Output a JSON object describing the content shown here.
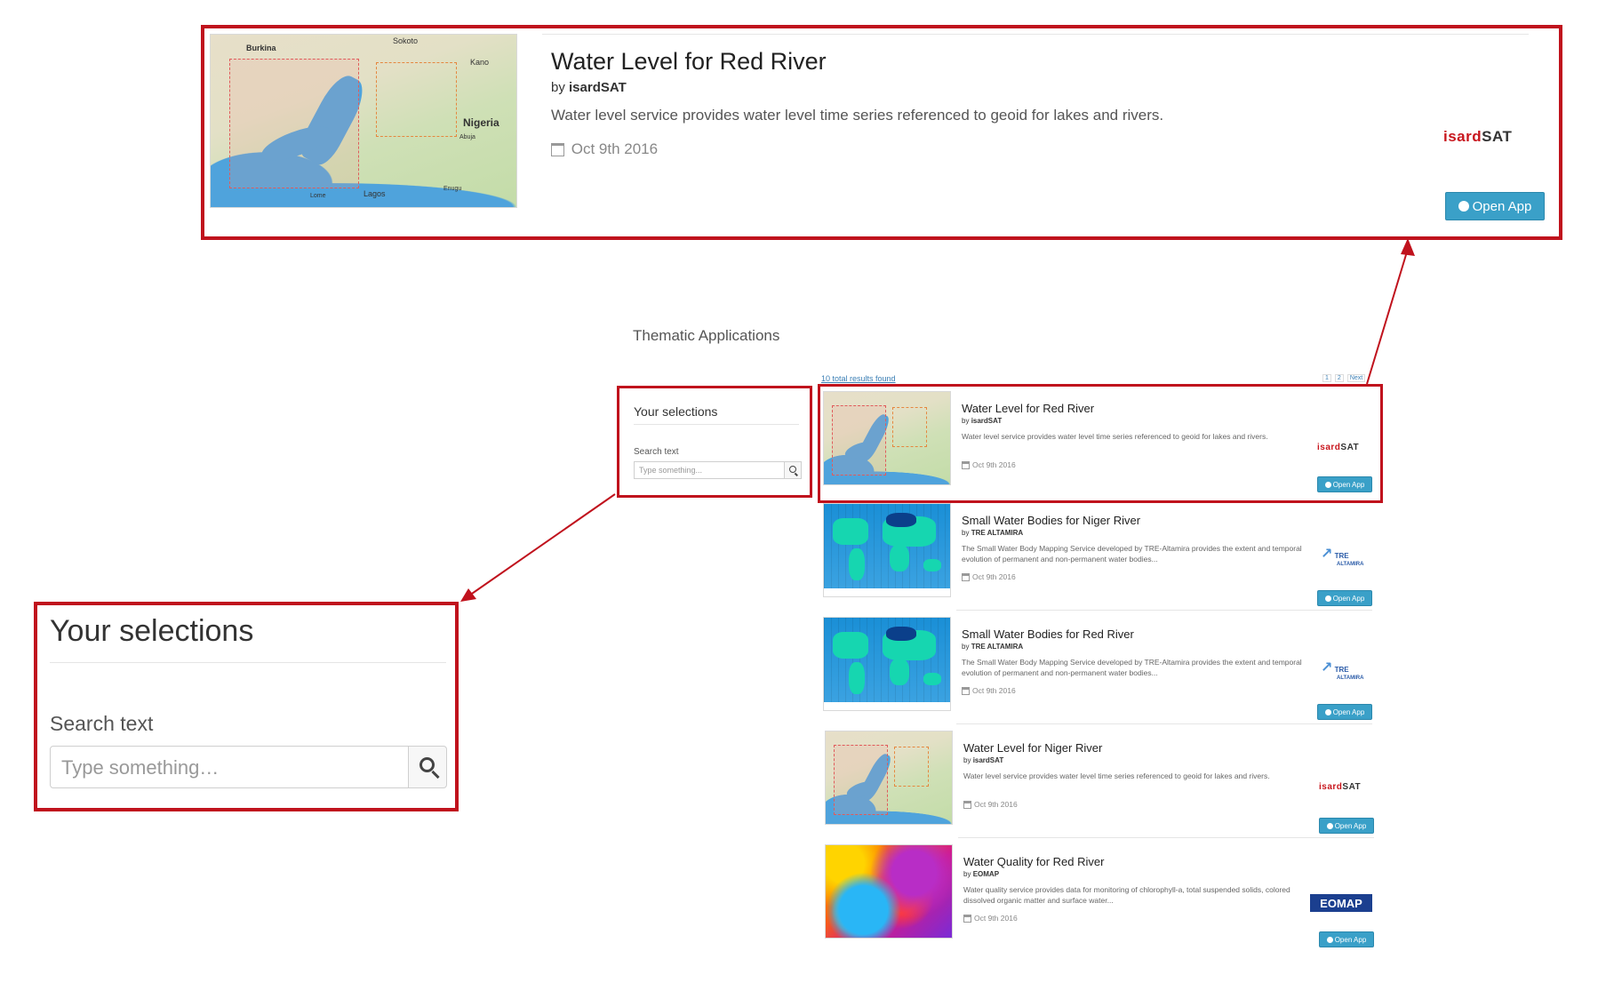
{
  "page": {
    "title": "Thematic Applications",
    "results_count": "10 total results found",
    "pagination": [
      "1",
      "2",
      "Next"
    ]
  },
  "sidebar": {
    "heading": "Your selections",
    "search_label": "Search text",
    "search_placeholder": "Type something..."
  },
  "zoom_sidebar": {
    "heading": "Your selections",
    "search_label": "Search text",
    "search_placeholder": "Type something…"
  },
  "featured": {
    "title": "Water Level for Red River",
    "by_prefix": "by",
    "provider": "isardSAT",
    "description": "Water level service provides water level time series referenced to geoid for lakes and rivers.",
    "date": "Oct 9th 2016",
    "button": "Open App",
    "map_labels": [
      "Burkina",
      "Sokoto",
      "Kano",
      "Nigeria",
      "Abuja",
      "Lome",
      "Lagos",
      "Enugu"
    ]
  },
  "results": [
    {
      "title": "Water Level for Red River",
      "by_prefix": "by",
      "provider": "isardSAT",
      "description": "Water level service provides water level time series referenced to geoid for lakes and rivers.",
      "date": "Oct 9th 2016",
      "button": "Open App",
      "logo": "isardSAT"
    },
    {
      "title": "Small Water Bodies for Niger River",
      "by_prefix": "by",
      "provider": "TRE ALTAMIRA",
      "description": "The Small Water Body Mapping Service developed by TRE-Altamira provides the extent and temporal evolution of permanent and non-permanent water bodies...",
      "date": "Oct 9th 2016",
      "button": "Open App",
      "logo": "TRE ALTAMIRA"
    },
    {
      "title": "Small Water Bodies for Red River",
      "by_prefix": "by",
      "provider": "TRE ALTAMIRA",
      "description": "The Small Water Body Mapping Service developed by TRE-Altamira provides the extent and temporal evolution of permanent and non-permanent water bodies...",
      "date": "Oct 9th 2016",
      "button": "Open App",
      "logo": "TRE ALTAMIRA"
    },
    {
      "title": "Water Level for Niger River",
      "by_prefix": "by",
      "provider": "isardSAT",
      "description": "Water level service provides water level time series referenced to geoid for lakes and rivers.",
      "date": "Oct 9th 2016",
      "button": "Open App",
      "logo": "isardSAT"
    },
    {
      "title": "Water Quality for Red River",
      "by_prefix": "by",
      "provider": "EOMAP",
      "description": "Water quality service provides data for monitoring of chlorophyll-a, total suspended solids, colored dissolved organic matter and surface water...",
      "date": "Oct 9th 2016",
      "button": "Open App",
      "logo": "EOMAP"
    }
  ],
  "colors": {
    "highlight": "#c0121d",
    "button": "#3aa0c8",
    "isard_red": "#c8161d",
    "eomap_blue": "#1b3f8f"
  },
  "icons": [
    "calendar-icon",
    "globe-icon",
    "search-icon"
  ]
}
